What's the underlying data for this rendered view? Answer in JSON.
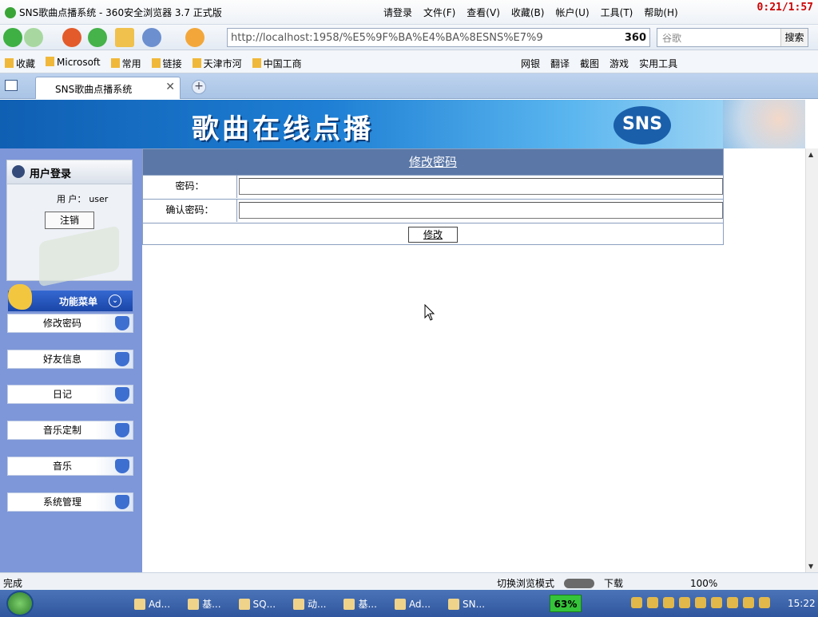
{
  "browser": {
    "title": "SNS歌曲点播系统 - 360安全浏览器 3.7 正式版",
    "menu": [
      "请登录",
      "文件(F)",
      "查看(V)",
      "收藏(B)",
      "帐户(U)",
      "工具(T)",
      "帮助(H)"
    ],
    "timer": "0:21/1:57",
    "address": "http://localhost:1958/%E5%9F%BA%E4%BA%8ESNS%E7%9",
    "address_badge": "360",
    "search_placeholder": "谷歌",
    "search_button": "搜索",
    "favorites": [
      "收藏",
      "Microsoft",
      "常用",
      "链接",
      "天津市河",
      "中国工商"
    ],
    "toolbar_right": [
      "网银",
      "翻译",
      "截图",
      "游戏",
      "实用工具"
    ],
    "tab_title": "SNS歌曲点播系统",
    "status_left": "完成",
    "status_mode": "切换浏览模式",
    "status_download": "下载",
    "zoom": "100%"
  },
  "page": {
    "banner_title": "歌曲在线点播",
    "banner_logo": "SNS",
    "login": {
      "header": "用户登录",
      "user_label": "用 户：",
      "user_value": "user",
      "logout": "注销"
    },
    "menu_header": "功能菜单",
    "menu_items": [
      "修改密码",
      "好友信息",
      "日记",
      "音乐定制",
      "音乐",
      "系统管理"
    ],
    "form": {
      "title": "修改密码",
      "password_label": "密码：",
      "confirm_label": "确认密码：",
      "submit": "修改"
    }
  },
  "taskbar": {
    "tasks": [
      "Ad...",
      "基...",
      "SQ...",
      "动...",
      "基...",
      "Ad...",
      "SN..."
    ],
    "battery": "63%",
    "clock": "15:22"
  }
}
